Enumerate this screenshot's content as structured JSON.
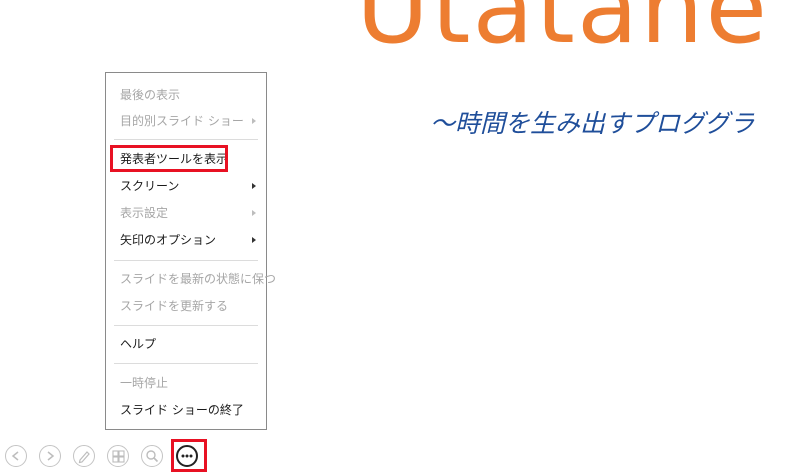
{
  "slide": {
    "title": "Utatane",
    "subtitle": "～時間を生み出すプロググラ"
  },
  "context_menu": {
    "items": [
      {
        "label": "最後の表示",
        "enabled": false
      },
      {
        "label": "目的別スライド ショー",
        "enabled": false,
        "submenu": true
      },
      {
        "label": "発表者ツールを表示",
        "enabled": true,
        "highlighted": true
      },
      {
        "label": "スクリーン",
        "enabled": true,
        "submenu": true
      },
      {
        "label": "表示設定",
        "enabled": false,
        "submenu": true
      },
      {
        "label": "矢印のオプション",
        "enabled": true,
        "submenu": true
      },
      {
        "label": "スライドを最新の状態に保つ",
        "enabled": false
      },
      {
        "label": "スライドを更新する",
        "enabled": false
      },
      {
        "label": "ヘルプ",
        "enabled": true
      },
      {
        "label": "一時停止",
        "enabled": false
      },
      {
        "label": "スライド ショーの終了",
        "enabled": true
      }
    ]
  },
  "toolbar": {
    "buttons": [
      {
        "icon": "previous-icon"
      },
      {
        "icon": "next-icon"
      },
      {
        "icon": "pen-icon"
      },
      {
        "icon": "see-all-slides-icon"
      },
      {
        "icon": "zoom-icon"
      },
      {
        "icon": "more-options-icon",
        "highlighted": true
      }
    ]
  },
  "colors": {
    "title": "#ED7D31",
    "subtitle": "#1F4E9A",
    "highlight": "#E81123",
    "disabled_text": "#A6A6A6"
  }
}
